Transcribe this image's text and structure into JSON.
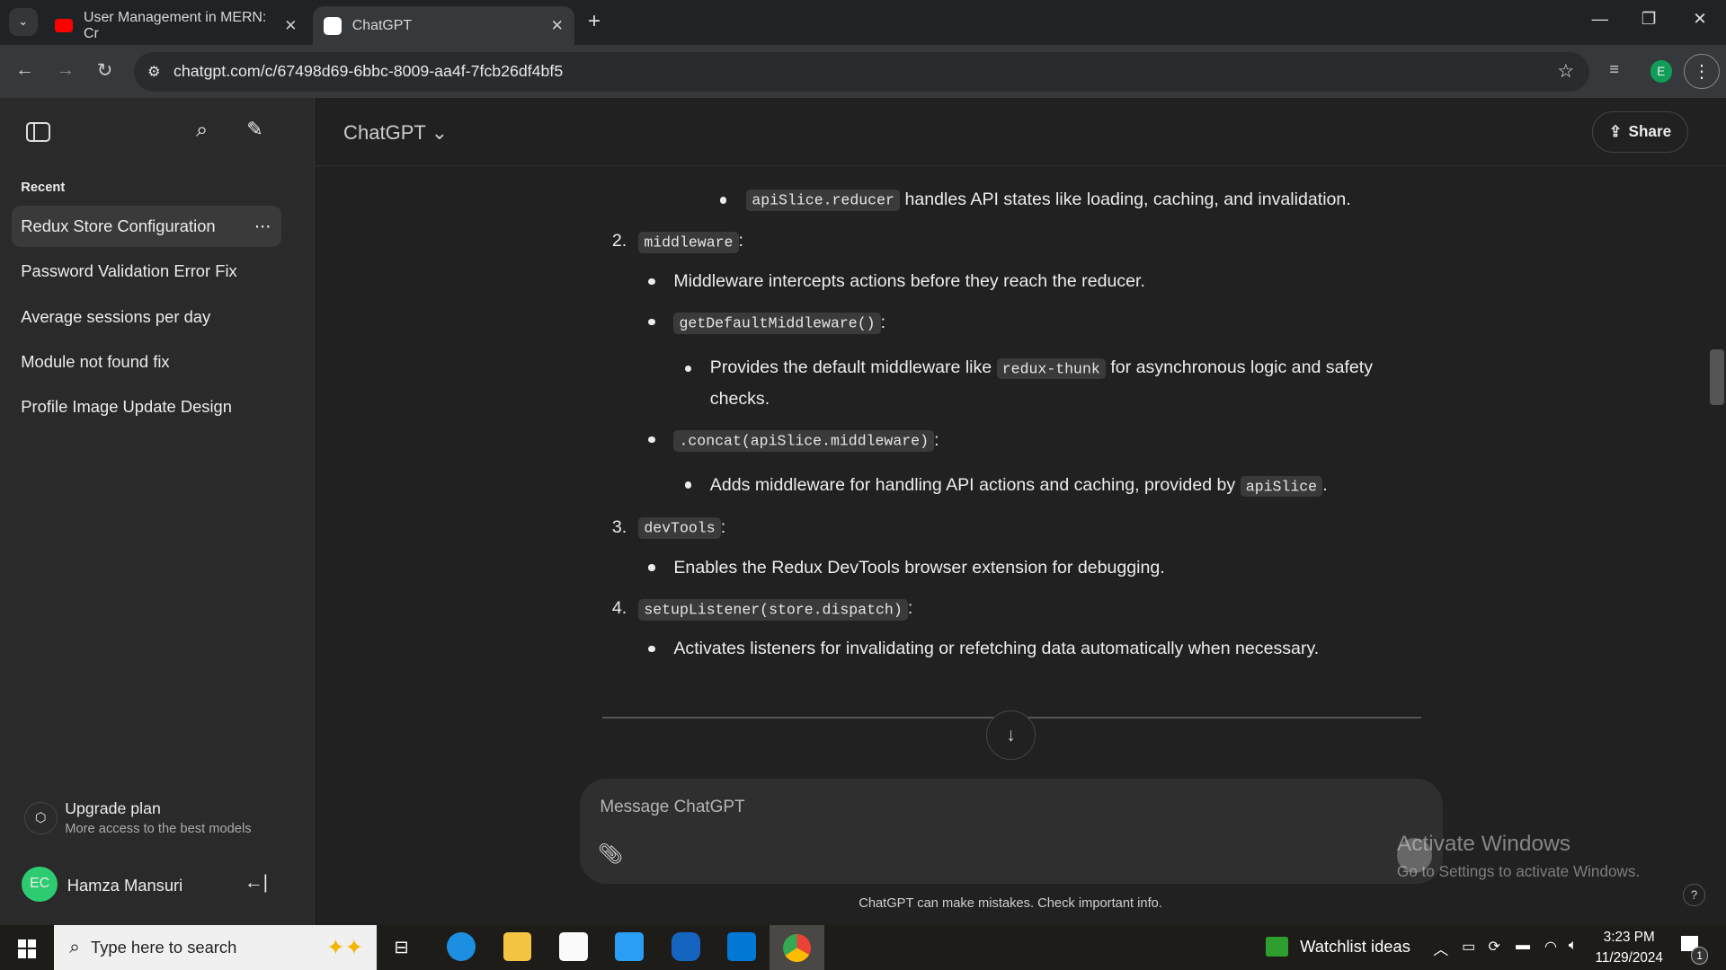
{
  "browser": {
    "tabs": [
      {
        "title": "User Management in MERN: Cr",
        "icon": "youtube-icon"
      },
      {
        "title": "ChatGPT",
        "icon": "chatgpt-icon"
      }
    ],
    "url": "chatgpt.com/c/67498d69-6bbc-8009-aa4f-7fcb26df4bf5",
    "profile_initial": "E"
  },
  "sidebar": {
    "recent_label": "Recent",
    "items": [
      {
        "label": "Redux Store Configuration"
      },
      {
        "label": "Password Validation Error Fix"
      },
      {
        "label": "Average sessions per day"
      },
      {
        "label": "Module not found fix"
      },
      {
        "label": "Profile Image Update Design"
      }
    ],
    "more": "⋯",
    "upgrade": {
      "title": "Upgrade plan",
      "subtitle": "More access to the best models"
    },
    "user": {
      "initials": "EC",
      "name": "Hamza Mansuri",
      "avatar_color": "#2ecc71"
    }
  },
  "header": {
    "model": "ChatGPT",
    "share": "Share"
  },
  "content": {
    "l0_code": "apiSlice.reducer",
    "l0_text": "handles API states like loading, caching, and invalidation.",
    "n2": "2.",
    "n2_code": "middleware",
    "m1": "Middleware intercepts actions before they reach the reducer.",
    "m2_code": "getDefaultMiddleware()",
    "m2a_pre": "Provides the default middleware like",
    "m2a_code": "redux-thunk",
    "m2a_post": "for asynchronous logic and safety",
    "m2a_cont": "checks.",
    "m3_code": ".concat(apiSlice.middleware)",
    "m3a_pre": "Adds middleware for handling API actions and caching, provided by",
    "m3a_code": "apiSlice",
    "n3": "3.",
    "n3_code": "devTools",
    "d1": "Enables the Redux DevTools browser extension for debugging.",
    "n4": "4.",
    "n4_code": "setupListener(store.dispatch)",
    "s1": "Activates listeners for invalidating or refetching data automatically when necessary.",
    "colon": ":",
    "period": "."
  },
  "composer": {
    "placeholder": "Message ChatGPT",
    "disclaimer": "ChatGPT can make mistakes. Check important info."
  },
  "watermark": {
    "title": "Activate Windows",
    "subtitle": "Go to Settings to activate Windows."
  },
  "help": "?",
  "taskbar": {
    "search_placeholder": "Type here to search",
    "widget": "Watchlist ideas",
    "time": "3:23 PM",
    "date": "11/29/2024",
    "notifications": "1"
  }
}
